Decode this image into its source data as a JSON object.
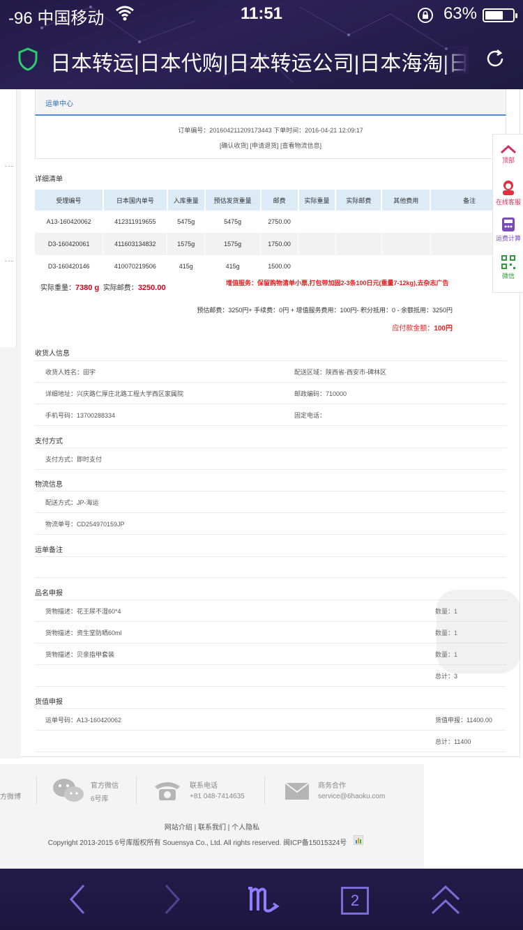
{
  "status": {
    "carrier": "-96 中国移动",
    "time": "11:51",
    "battery": "63%",
    "battery_level": 0.63
  },
  "browser": {
    "url_title": "日本转运|日本代购|日本转运公司|日本海淘|日本代购",
    "shield_icon": "shield-icon",
    "reload_icon": "reload-icon"
  },
  "page": {
    "tab": "运单中心",
    "order": {
      "line1": "订单编号：201604211209173443  下单时间：2016-04-21 12:09:17",
      "line2": "[确认收货] [申请退货] [查看物流信息]"
    },
    "detail_title": "详细清单",
    "table": {
      "headers": [
        "受理编号",
        "日本国内单号",
        "入库重量",
        "预估发货重量",
        "邮费",
        "实际重量",
        "实际邮费",
        "其他费用",
        "备注"
      ],
      "rows": [
        [
          "A13-160420062",
          "412311919655",
          "5475g",
          "5475g",
          "2750.00",
          "",
          "",
          "",
          ""
        ],
        [
          "D3-160420061",
          "411603134832",
          "1575g",
          "1575g",
          "1750.00",
          "",
          "",
          "",
          ""
        ],
        [
          "D3-160420146",
          "410070219506",
          "415g",
          "415g",
          "1500.00",
          "",
          "",
          "",
          ""
        ]
      ]
    },
    "actual_weight_label": "实际重量：",
    "actual_weight": "7380 g",
    "actual_fee_label": "实际邮费：",
    "actual_fee": "3250.00",
    "service_note": "增值服务：保留购物清单小票,打包带加固2-3条100日元(重量7-12kg),去杂志广告",
    "fee_summary": "预估邮费：3250円+ 手续费：0円 + 增值服务费用：100円- 积分抵用：0 - 余额抵用：3250円",
    "payable_label": "应付款金额：",
    "payable": "100円",
    "receiver": {
      "title": "收货人信息",
      "name": "收货人姓名：田宇",
      "region": "配送区域：陕西省-西安市-碑林区",
      "address": "详细地址：兴庆路仁厚庄北路工程大学西区家属院",
      "zip": "邮政编码：710000",
      "mobile": "手机号码：13700288334",
      "phone": "固定电话："
    },
    "payment": {
      "title": "支付方式",
      "method": "支付方式：即时支付"
    },
    "logistics": {
      "title": "物流信息",
      "method": "配送方式：JP-海运",
      "number": "物流单号：CD254970159JP"
    },
    "remark_title": "运单备注",
    "goods": {
      "title": "品名申报",
      "items": [
        {
          "desc": "货物描述：花王尿不湿60*4",
          "qty": "数量：1"
        },
        {
          "desc": "货物描述：资生堂防晒60ml",
          "qty": "数量：1"
        },
        {
          "desc": "货物描述：贝亲指甲套装",
          "qty": "数量：1"
        }
      ],
      "total": "总计：3"
    },
    "value": {
      "title": "货值申报",
      "waybill": "运单号码：A13-160420062",
      "declared": "货值申报：11400.00",
      "total": "总计：11400"
    }
  },
  "footer": {
    "weibo": "方微博",
    "wechat_title": "官方微信",
    "wechat_sub": "6号库",
    "phone_title": "联系电话",
    "phone_sub": "+81 048-7414635",
    "biz_title": "商务合作",
    "biz_sub": "service@6haoku.com",
    "links": "网站介绍 | 联系我们 | 个人隐私",
    "copyright": "Copyright 2013-2015 6号库版权所有 Souensya Co., Ltd. All rights reserved. 闽ICP备15015324号"
  },
  "sidebar": {
    "top": "顶部",
    "service": "在线客服",
    "calc": "运费计算",
    "wechat": "微信"
  },
  "bottom_nav": {
    "tabs_count": "2"
  }
}
